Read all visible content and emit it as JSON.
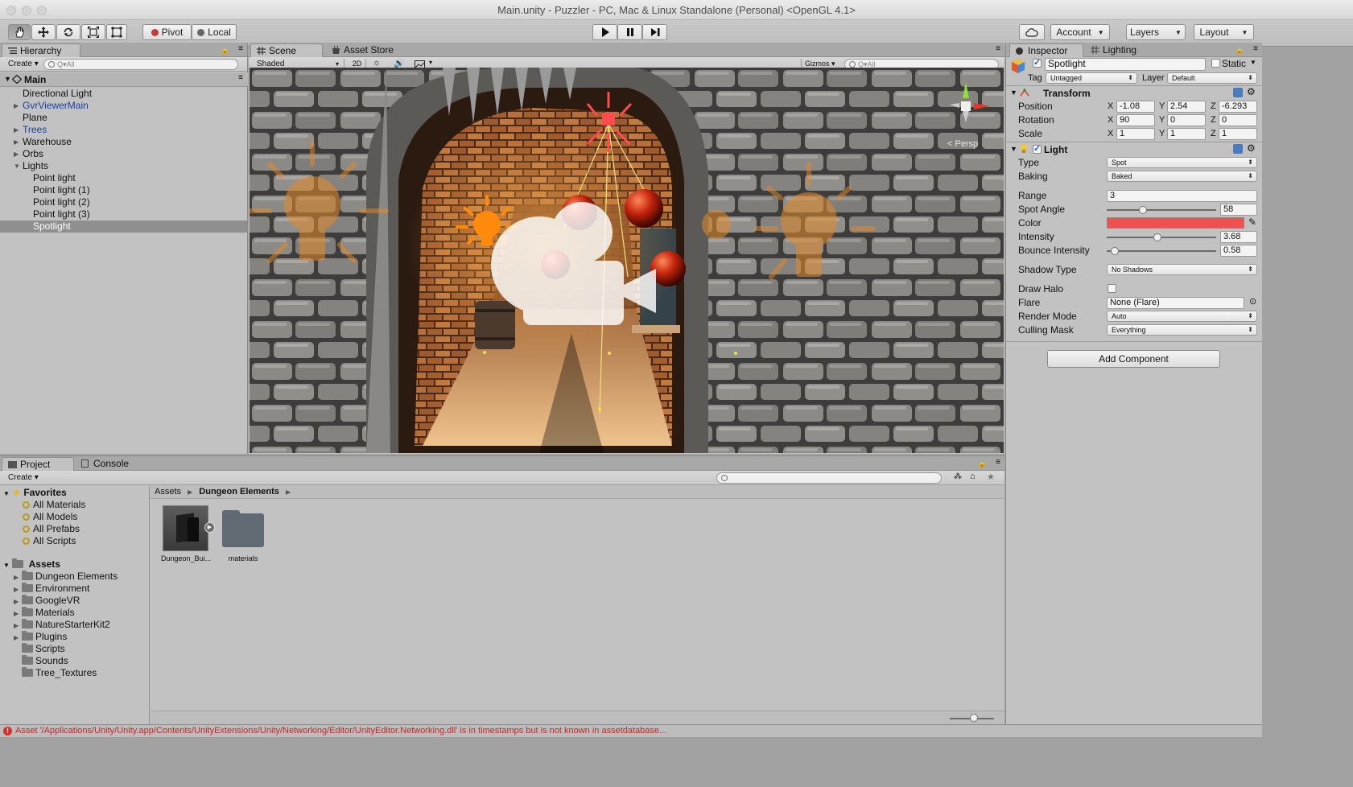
{
  "window": {
    "title": "Main.unity - Puzzler - PC, Mac & Linux Standalone (Personal) <OpenGL 4.1>"
  },
  "toolbar": {
    "tools": [
      "hand-tool",
      "move-tool",
      "rotate-tool",
      "scale-tool",
      "rect-tool"
    ],
    "pivot_label": "Pivot",
    "local_label": "Local",
    "account_label": "Account",
    "layers_label": "Layers",
    "layout_label": "Layout"
  },
  "hierarchy": {
    "tab_label": "Hierarchy",
    "create_label": "Create",
    "search_placeholder": "Q▾All",
    "scene_name": "Main",
    "items": [
      {
        "label": "Directional Light",
        "indent": 1,
        "expandable": false,
        "prefab": false
      },
      {
        "label": "GvrViewerMain",
        "indent": 1,
        "expandable": true,
        "prefab": true
      },
      {
        "label": "Plane",
        "indent": 1,
        "expandable": false,
        "prefab": false
      },
      {
        "label": "Trees",
        "indent": 1,
        "expandable": true,
        "prefab": true
      },
      {
        "label": "Warehouse",
        "indent": 1,
        "expandable": true,
        "prefab": false
      },
      {
        "label": "Orbs",
        "indent": 1,
        "expandable": true,
        "prefab": false
      },
      {
        "label": "Lights",
        "indent": 1,
        "expandable": true,
        "expanded": true,
        "prefab": false
      },
      {
        "label": "Point light",
        "indent": 2,
        "expandable": false,
        "prefab": false
      },
      {
        "label": "Point light (1)",
        "indent": 2,
        "expandable": false,
        "prefab": false
      },
      {
        "label": "Point light (2)",
        "indent": 2,
        "expandable": false,
        "prefab": false
      },
      {
        "label": "Point light (3)",
        "indent": 2,
        "expandable": false,
        "prefab": false
      },
      {
        "label": "Spotlight",
        "indent": 2,
        "expandable": false,
        "prefab": false,
        "selected": true
      }
    ]
  },
  "scene": {
    "tab_label": "Scene",
    "asset_store_label": "Asset Store",
    "shading_mode": "Shaded",
    "mode_2d_label": "2D",
    "gizmos_label": "Gizmos",
    "search_placeholder": "Q▾All",
    "persp_label": "< Persp"
  },
  "inspector": {
    "tab_label": "Inspector",
    "lighting_tab_label": "Lighting",
    "object_name": "Spotlight",
    "static_label": "Static",
    "tag_label": "Tag",
    "tag_value": "Untagged",
    "layer_label": "Layer",
    "layer_value": "Default",
    "transform": {
      "header": "Transform",
      "position_label": "Position",
      "rotation_label": "Rotation",
      "scale_label": "Scale",
      "position": {
        "x": "-1.08",
        "y": "2.54",
        "z": "-6.293"
      },
      "rotation": {
        "x": "90",
        "y": "0",
        "z": "0"
      },
      "scale": {
        "x": "1",
        "y": "1",
        "z": "1"
      }
    },
    "light": {
      "header": "Light",
      "type_label": "Type",
      "type_value": "Spot",
      "baking_label": "Baking",
      "baking_value": "Baked",
      "range_label": "Range",
      "range_value": "3",
      "spot_angle_label": "Spot Angle",
      "spot_angle_value": "58",
      "spot_angle_fraction": 0.33,
      "color_label": "Color",
      "color_value": "#f24f4f",
      "intensity_label": "Intensity",
      "intensity_value": "3.68",
      "intensity_fraction": 0.46,
      "bounce_label": "Bounce Intensity",
      "bounce_value": "0.58",
      "bounce_fraction": 0.07,
      "shadow_type_label": "Shadow Type",
      "shadow_type_value": "No Shadows",
      "draw_halo_label": "Draw Halo",
      "flare_label": "Flare",
      "flare_value": "None (Flare)",
      "render_mode_label": "Render Mode",
      "render_mode_value": "Auto",
      "culling_mask_label": "Culling Mask",
      "culling_mask_value": "Everything"
    },
    "add_component_label": "Add Component"
  },
  "project": {
    "tab_label": "Project",
    "console_tab_label": "Console",
    "create_label": "Create",
    "favorites_label": "Favorites",
    "favorites": [
      "All Materials",
      "All Models",
      "All Prefabs",
      "All Scripts"
    ],
    "assets_label": "Assets",
    "asset_folders": [
      {
        "label": "Dungeon Elements",
        "expandable": true
      },
      {
        "label": "Environment",
        "expandable": true
      },
      {
        "label": "GoogleVR",
        "expandable": true
      },
      {
        "label": "Materials",
        "expandable": true
      },
      {
        "label": "NatureStarterKit2",
        "expandable": true
      },
      {
        "label": "Plugins",
        "expandable": true
      },
      {
        "label": "Scripts",
        "expandable": false
      },
      {
        "label": "Sounds",
        "expandable": false
      },
      {
        "label": "Tree_Textures",
        "expandable": false
      }
    ],
    "breadcrumb": [
      "Assets",
      "Dungeon Elements"
    ],
    "grid_items": [
      {
        "label": "Dungeon_Bui...",
        "kind": "model"
      },
      {
        "label": "materials",
        "kind": "folder"
      }
    ]
  },
  "status_bar": {
    "message": "Asset '/Applications/Unity/Unity.app/Contents/UnityExtensions/Unity/Networking/Editor/UnityEditor.Networking.dll' is in timestamps but is not known in assetdatabase..."
  },
  "colors": {
    "panel_bg": "#c2c2c2",
    "selected_row": "#8f8f8f",
    "prefab_blue": "#1a3fa5",
    "error_red": "#c62828",
    "light_color": "#f24f4f"
  }
}
